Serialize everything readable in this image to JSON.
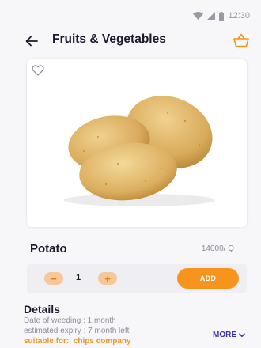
{
  "status_bar": {
    "time": "12:30",
    "icons": [
      "wifi-icon",
      "signal-icon",
      "battery-icon"
    ]
  },
  "header": {
    "title": "Fruits & Vegetables",
    "back_icon": "arrow-left-icon",
    "cart_icon": "basket-icon"
  },
  "product": {
    "name": "Potato",
    "price": "14000/ Q",
    "quantity": "1",
    "favorite_icon": "heart-outline-icon"
  },
  "actions": {
    "minus": "−",
    "plus": "+",
    "add_label": "ADD"
  },
  "details": {
    "title": "Details",
    "weeding": "Date of weeding : 1 month",
    "expiry": "estimated expiry : 7 month left",
    "suitable_label": "suitable for:",
    "suitable_value": "chips company",
    "more_label": "MORE"
  },
  "colors": {
    "accent": "#f7941d",
    "link": "#3a2fb8",
    "text": "#1c1b2e",
    "muted": "#8e8e99"
  }
}
